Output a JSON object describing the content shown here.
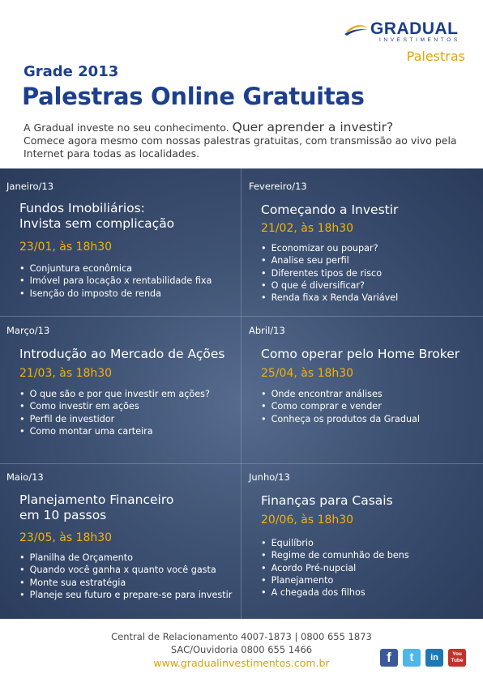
{
  "brand": {
    "name": "GRADUAL",
    "subtitle": "INVESTIMENTOS",
    "tag": "Palestras"
  },
  "header": {
    "kicker": "Grade 2013",
    "headline": "Palestras Online Gratuitas"
  },
  "intro": {
    "part1": "A Gradual investe no seu conhecimento.",
    "part2": "Quer aprender a investir?",
    "part3": "Comece agora mesmo com nossas palestras gratuitas, com transmissão ao vivo pela Internet para todas as localidades."
  },
  "sessions": [
    {
      "month": "Janeiro/13",
      "title_line1": "Fundos Imobiliários:",
      "title_line2": "Invista sem complicação",
      "date": "23/01, às 18h30",
      "topics": [
        "Conjuntura econômica",
        "Imóvel para locação x rentabilidade fixa",
        "Isenção do imposto de renda"
      ]
    },
    {
      "month": "Fevereiro/13",
      "title_line1": "Começando a Investir",
      "title_line2": "",
      "date": "21/02, às 18h30",
      "topics": [
        "Economizar ou poupar?",
        "Analise seu perfil",
        "Diferentes tipos de risco",
        "O que é diversificar?",
        "Renda fixa x Renda Variável"
      ]
    },
    {
      "month": "Março/13",
      "title_line1": "Introdução ao Mercado de Ações",
      "title_line2": "",
      "date": "21/03, às 18h30",
      "topics": [
        "O que são e por que investir em ações?",
        "Como investir em ações",
        "Perfil de investidor",
        "Como montar uma carteira"
      ]
    },
    {
      "month": "Abril/13",
      "title_line1": "Como operar pelo Home Broker",
      "title_line2": "",
      "date": "25/04, às 18h30",
      "topics": [
        "Onde encontrar análises",
        "Como comprar e vender",
        "Conheça os produtos da Gradual"
      ]
    },
    {
      "month": "Maio/13",
      "title_line1": "Planejamento Financeiro",
      "title_line2": "em 10 passos",
      "date": "23/05, às 18h30",
      "topics": [
        "Planilha de Orçamento",
        "Quando você ganha x quanto você gasta",
        "Monte sua estratégia",
        "Planeje seu futuro e prepare-se para investir"
      ]
    },
    {
      "month": "Junho/13",
      "title_line1": "Finanças para Casais",
      "title_line2": "",
      "date": "20/06, às 18h30",
      "topics": [
        "Equilíbrio",
        "Regime de comunhão de bens",
        "Acordo Pré-nupcial",
        "Planejamento",
        "A chegada dos filhos"
      ]
    }
  ],
  "footer": {
    "phones": "Central de Relacionamento 4007-1873 | 0800 655 1873",
    "ombudsman": "SAC/Ouvidoria 0800 655 1466",
    "website": "www.gradualinvestimentos.com.br"
  },
  "social": [
    {
      "name": "facebook",
      "glyph": "f",
      "color": "#3b5998"
    },
    {
      "name": "twitter",
      "glyph": "t",
      "color": "#4fb7e8"
    },
    {
      "name": "linkedin",
      "glyph": "in",
      "color": "#1e78b4"
    },
    {
      "name": "youtube",
      "glyph": "You Tube",
      "color": "#c4302b"
    }
  ]
}
